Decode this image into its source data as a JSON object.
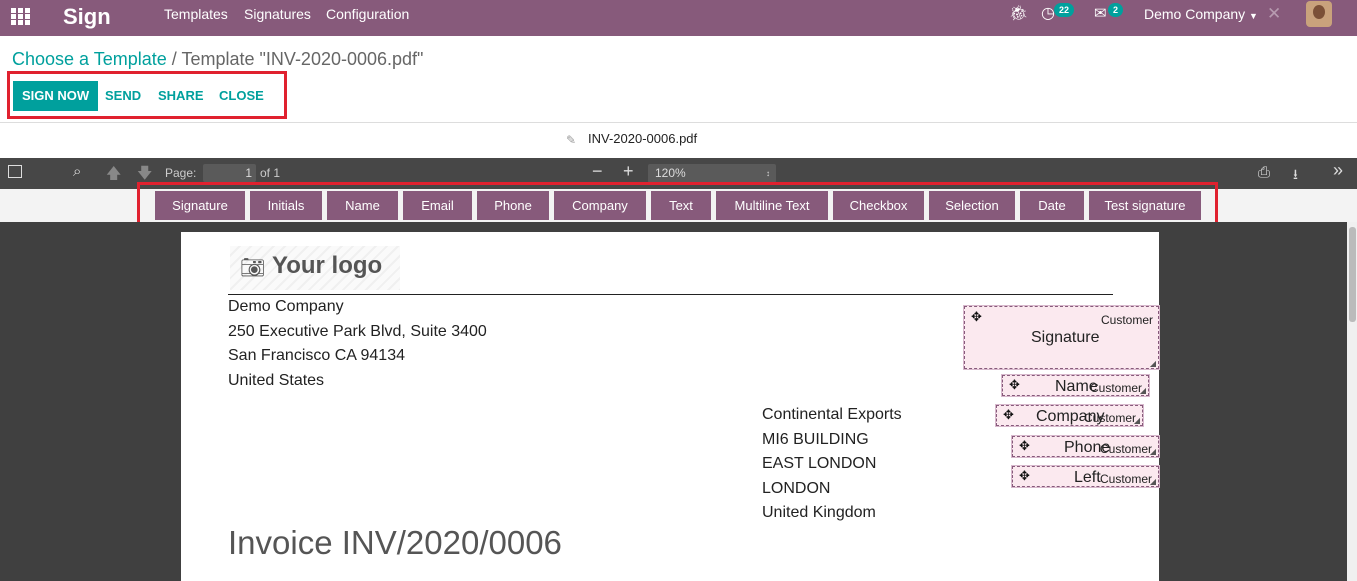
{
  "nav": {
    "app_name": "Sign",
    "menu": [
      "Templates",
      "Signatures",
      "Configuration"
    ],
    "activity_count": "22",
    "messages_count": "2",
    "company": "Demo Company"
  },
  "breadcrumb": {
    "parent": "Choose a Template",
    "separator": "/",
    "current": "Template \"INV-2020-0006.pdf\""
  },
  "actions": {
    "sign_now": "SIGN NOW",
    "send": "SEND",
    "share": "SHARE",
    "close": "CLOSE"
  },
  "document": {
    "filename": "INV-2020-0006.pdf"
  },
  "pdf_toolbar": {
    "page_label": "Page:",
    "page_value": "1",
    "page_total": "of 1",
    "zoom": "120%"
  },
  "field_types": [
    "Signature",
    "Initials",
    "Name",
    "Email",
    "Phone",
    "Company",
    "Text",
    "Multiline Text",
    "Checkbox",
    "Selection",
    "Date",
    "Test signature"
  ],
  "pdf": {
    "logo_text": "Your logo",
    "company_address": [
      "Demo Company",
      "250 Executive Park Blvd, Suite 3400",
      "San Francisco CA 94134",
      "United States"
    ],
    "customer_address": [
      "Continental Exports",
      "MI6 BUILDING",
      "EAST LONDON",
      "LONDON",
      "United Kingdom"
    ],
    "invoice_title": "Invoice INV/2020/0006"
  },
  "sign_fields": [
    {
      "label": "Signature",
      "role": "Customer"
    },
    {
      "label": "Name",
      "role": "Customer"
    },
    {
      "label": "Company",
      "role": "Customer"
    },
    {
      "label": "Phone",
      "role": "Customer"
    },
    {
      "label": "Left",
      "role": "Customer"
    }
  ]
}
